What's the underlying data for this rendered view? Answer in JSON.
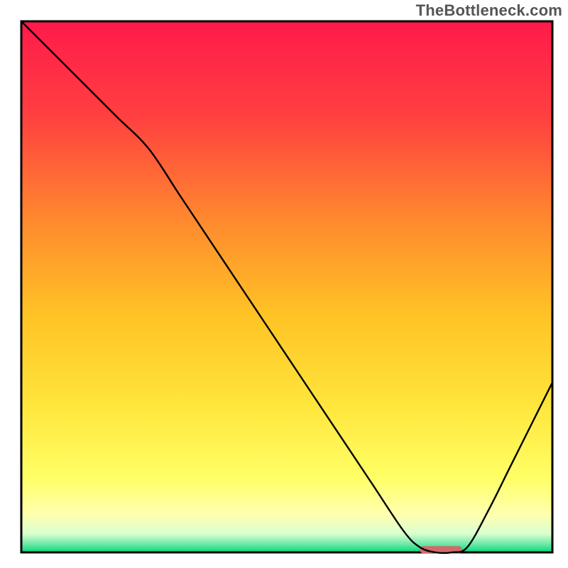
{
  "watermark": "TheBottleneck.com",
  "chart_data": {
    "type": "line",
    "title": "",
    "xlabel": "",
    "ylabel": "",
    "xlim": [
      0,
      100
    ],
    "ylim": [
      0,
      100
    ],
    "axes_visible": false,
    "grid": false,
    "background_gradient": {
      "direction": "vertical",
      "stops": [
        {
          "offset": 0.0,
          "color": "#ff1a4b"
        },
        {
          "offset": 0.18,
          "color": "#ff4040"
        },
        {
          "offset": 0.38,
          "color": "#ff8b2e"
        },
        {
          "offset": 0.55,
          "color": "#ffc225"
        },
        {
          "offset": 0.72,
          "color": "#ffe53b"
        },
        {
          "offset": 0.86,
          "color": "#ffff66"
        },
        {
          "offset": 0.93,
          "color": "#ffffb0"
        },
        {
          "offset": 0.965,
          "color": "#d9ffd0"
        },
        {
          "offset": 0.985,
          "color": "#69e8a5"
        },
        {
          "offset": 1.0,
          "color": "#00d87a"
        }
      ]
    },
    "series": [
      {
        "name": "bottleneck-curve",
        "color": "#000000",
        "stroke_width": 2.4,
        "x": [
          0,
          6,
          12,
          18,
          24,
          30,
          36,
          42,
          48,
          54,
          60,
          66,
          72,
          75,
          78,
          81,
          84,
          88,
          92,
          96,
          100
        ],
        "y": [
          100,
          94,
          88,
          82,
          76,
          67,
          58,
          49,
          40,
          31,
          22,
          13,
          4,
          1,
          0,
          0,
          1,
          8,
          16,
          24,
          32
        ]
      }
    ],
    "marker": {
      "name": "optimal-zone-marker",
      "x_start": 75,
      "x_end": 83,
      "y": 0.5,
      "color": "#d16a6a",
      "thickness": 10
    }
  }
}
